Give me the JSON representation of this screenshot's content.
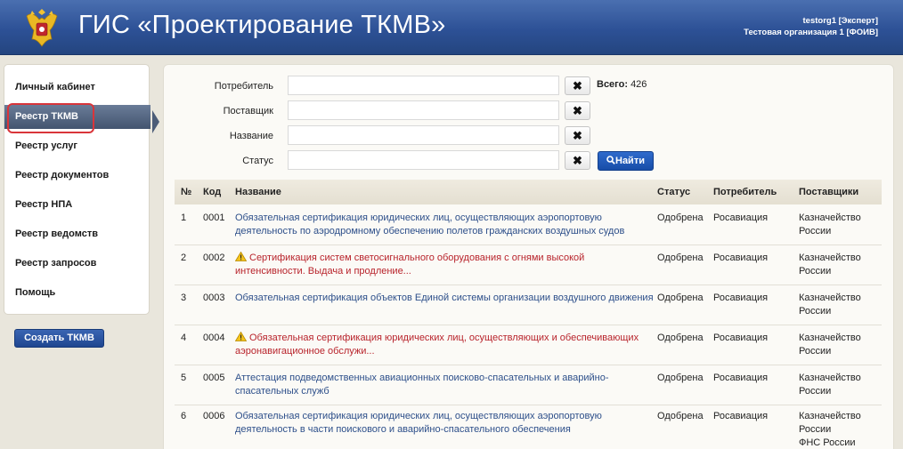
{
  "header": {
    "title": "ГИС «Проектирование ТКМВ»",
    "user_name": "testorg1 [Эксперт]",
    "org_name": "Тестовая организация 1 [ФОИВ]"
  },
  "sidebar": {
    "items": [
      {
        "label": "Личный кабинет"
      },
      {
        "label": "Реестр ТКМВ"
      },
      {
        "label": "Реестр услуг"
      },
      {
        "label": "Реестр документов"
      },
      {
        "label": "Реестр НПА"
      },
      {
        "label": "Реестр ведомств"
      },
      {
        "label": "Реестр запросов"
      },
      {
        "label": "Помощь"
      }
    ],
    "active_index": 1,
    "create_button": "Создать ТКМВ"
  },
  "filters": {
    "consumer_label": "Потребитель",
    "supplier_label": "Поставщик",
    "name_label": "Название",
    "status_label": "Статус",
    "consumer_value": "",
    "supplier_value": "",
    "name_value": "",
    "status_value": "",
    "clear_glyph": "✖",
    "total_label": "Всего:",
    "total_value": "426",
    "find_button": "Найти"
  },
  "table": {
    "headers": {
      "num": "№",
      "code": "Код",
      "name": "Название",
      "status": "Статус",
      "consumer": "Потребитель",
      "suppliers": "Поставщики"
    },
    "rows": [
      {
        "num": "1",
        "code": "0001",
        "warning": false,
        "name": "Обязательная сертификация юридических лиц, осуществляющих аэропортовую деятельность по аэродромному обеспечению полетов гражданских воздушных судов",
        "status": "Одобрена",
        "consumer": "Росавиация",
        "suppliers": [
          "Казначейство России"
        ]
      },
      {
        "num": "2",
        "code": "0002",
        "warning": true,
        "name": "Сертификация систем светосигнального оборудования с огнями высокой интенсивности. Выдача и продление...",
        "status": "Одобрена",
        "consumer": "Росавиация",
        "suppliers": [
          "Казначейство России"
        ]
      },
      {
        "num": "3",
        "code": "0003",
        "warning": false,
        "name": "Обязательная сертификация объектов Единой системы организации воздушного движения",
        "status": "Одобрена",
        "consumer": "Росавиация",
        "suppliers": [
          "Казначейство России"
        ]
      },
      {
        "num": "4",
        "code": "0004",
        "warning": true,
        "name": "Обязательная сертификация юридических лиц, осуществляющих и обеспечивающих аэронавигационное обслужи...",
        "status": "Одобрена",
        "consumer": "Росавиация",
        "suppliers": [
          "Казначейство России"
        ]
      },
      {
        "num": "5",
        "code": "0005",
        "warning": false,
        "name": "Аттестация подведомственных авиационных поисково-спасательных и аварийно-спасательных служб",
        "status": "Одобрена",
        "consumer": "Росавиация",
        "suppliers": [
          "Казначейство России"
        ]
      },
      {
        "num": "6",
        "code": "0006",
        "warning": false,
        "name": "Обязательная сертификация юридических лиц, осуществляющих аэропортовую деятельность в части поискового и аварийно-спасательного обеспечения",
        "status": "Одобрена",
        "consumer": "Росавиация",
        "suppliers": [
          "Казначейство России",
          "ФНС России"
        ]
      }
    ]
  },
  "colors": {
    "header_blue": "#2d5196",
    "link_blue": "#2d4f8a",
    "warning_red": "#b8232b",
    "highlight_red": "#d9353a"
  },
  "icons": {
    "emblem": "coat-of-arms-icon",
    "clear": "close-icon",
    "search": "search-icon",
    "warning": "warning-icon"
  }
}
